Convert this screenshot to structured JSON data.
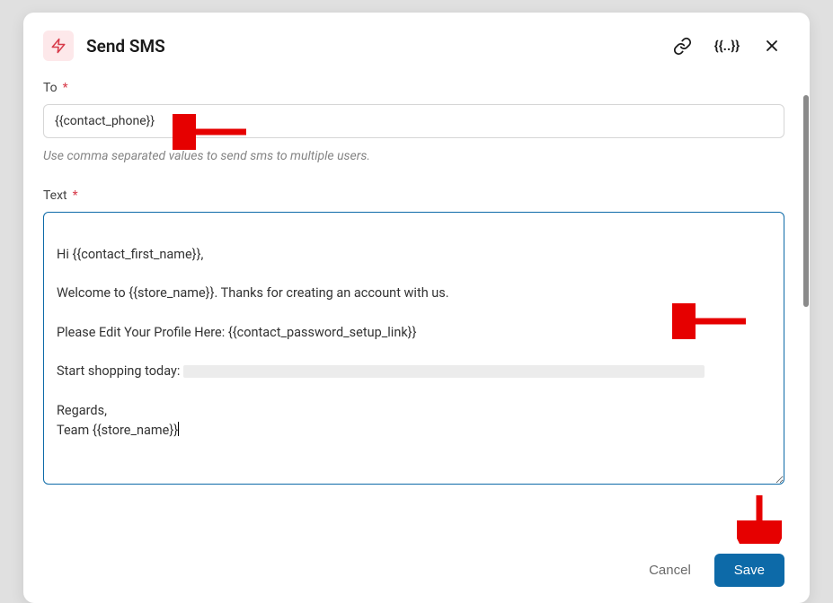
{
  "header": {
    "title": "Send SMS"
  },
  "to": {
    "label": "To",
    "value": "{{contact_phone}}",
    "hint": "Use comma separated values to send sms to multiple users."
  },
  "text": {
    "label": "Text",
    "line1": "Hi {{contact_first_name}},",
    "line2": "Welcome to {{store_name}}. Thanks for creating an account with us.",
    "line3": "Please Edit Your Profile Here: {{contact_password_setup_link}}",
    "line4_prefix": "Start shopping today:",
    "line5": "Regards,",
    "line6": "Team {{store_name}}"
  },
  "footer": {
    "cancel": "Cancel",
    "save": "Save"
  }
}
